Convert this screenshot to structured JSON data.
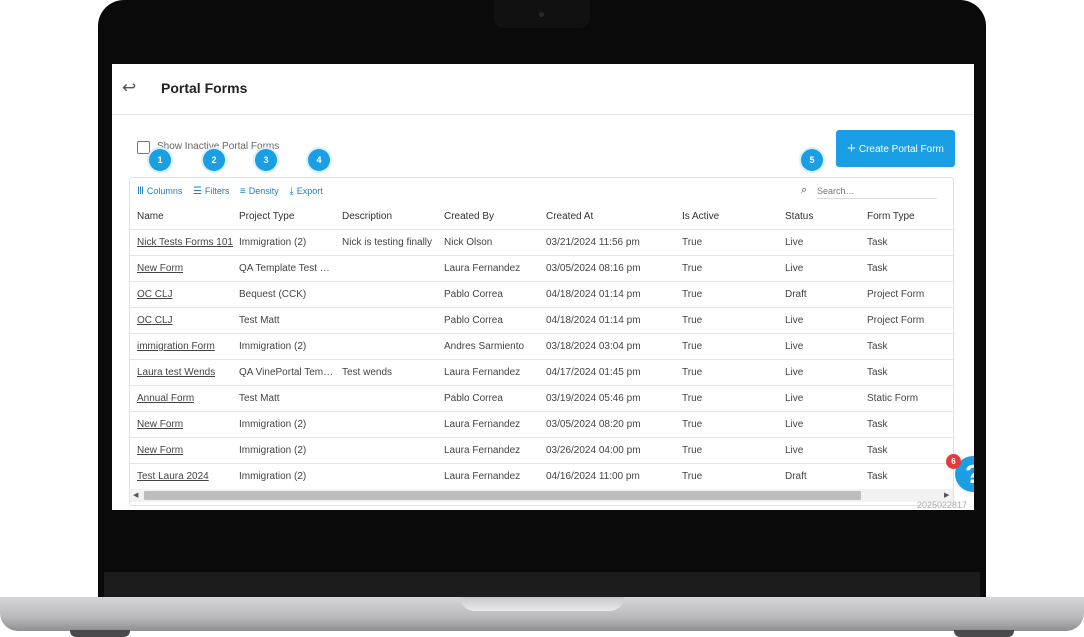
{
  "header": {
    "back_icon": "↩",
    "title": "Portal Forms"
  },
  "show_inactive": {
    "label": "Show Inactive Portal Forms",
    "checked": false
  },
  "create_button": {
    "icon": "+",
    "label": "Create Portal Form"
  },
  "callouts": [
    "1",
    "2",
    "3",
    "4",
    "5"
  ],
  "toolbar": {
    "columns": {
      "icon": "Ⅲ",
      "label": "Columns"
    },
    "filters": {
      "icon": "☰",
      "label": "Filters"
    },
    "density": {
      "icon": "≡",
      "label": "Density"
    },
    "export": {
      "icon": "⤓",
      "label": "Export"
    }
  },
  "search": {
    "icon": "⌕",
    "placeholder": "Search…"
  },
  "table": {
    "columns": [
      "Name",
      "Project Type",
      "Description",
      "Created By",
      "Created At",
      "Is Active",
      "Status",
      "Form Type"
    ],
    "rows": [
      [
        "Nick Tests Forms 101",
        "Immigration (2)",
        "Nick is testing finally",
        "Nick Olson",
        "03/21/2024 11:56 pm",
        "True",
        "Live",
        "Task"
      ],
      [
        "New Form",
        "QA Template Test …",
        "",
        "Laura Fernandez",
        "03/05/2024 08:16 pm",
        "True",
        "Live",
        "Task"
      ],
      [
        "OC CLJ",
        "Bequest (CCK)",
        "",
        "Pablo Correa",
        "04/18/2024 01:14 pm",
        "True",
        "Draft",
        "Project Form"
      ],
      [
        "OC CLJ",
        "Test Matt",
        "",
        "Pablo Correa",
        "04/18/2024 01:14 pm",
        "True",
        "Live",
        "Project Form"
      ],
      [
        "immigration Form",
        "Immigration (2)",
        "",
        "Andres Sarmiento",
        "03/18/2024 03:04 pm",
        "True",
        "Live",
        "Task"
      ],
      [
        "Laura test Wends",
        "QA VinePortal Tem…",
        "Test wends",
        "Laura Fernandez",
        "04/17/2024 01:45 pm",
        "True",
        "Live",
        "Task"
      ],
      [
        "Annual Form",
        "Test Matt",
        "",
        "Pablo Correa",
        "03/19/2024 05:46 pm",
        "True",
        "Live",
        "Static Form"
      ],
      [
        "New Form",
        "Immigration (2)",
        "",
        "Laura Fernandez",
        "03/05/2024 08:20 pm",
        "True",
        "Live",
        "Task"
      ],
      [
        "New Form",
        "Immigration (2)",
        "",
        "Laura Fernandez",
        "03/26/2024 04:00 pm",
        "True",
        "Live",
        "Task"
      ],
      [
        "Test Laura 2024",
        "Immigration (2)",
        "",
        "Laura Fernandez",
        "04/16/2024 11:00 pm",
        "True",
        "Draft",
        "Task"
      ]
    ]
  },
  "help": {
    "icon": "?",
    "badge": "6"
  },
  "version": "2025022817"
}
